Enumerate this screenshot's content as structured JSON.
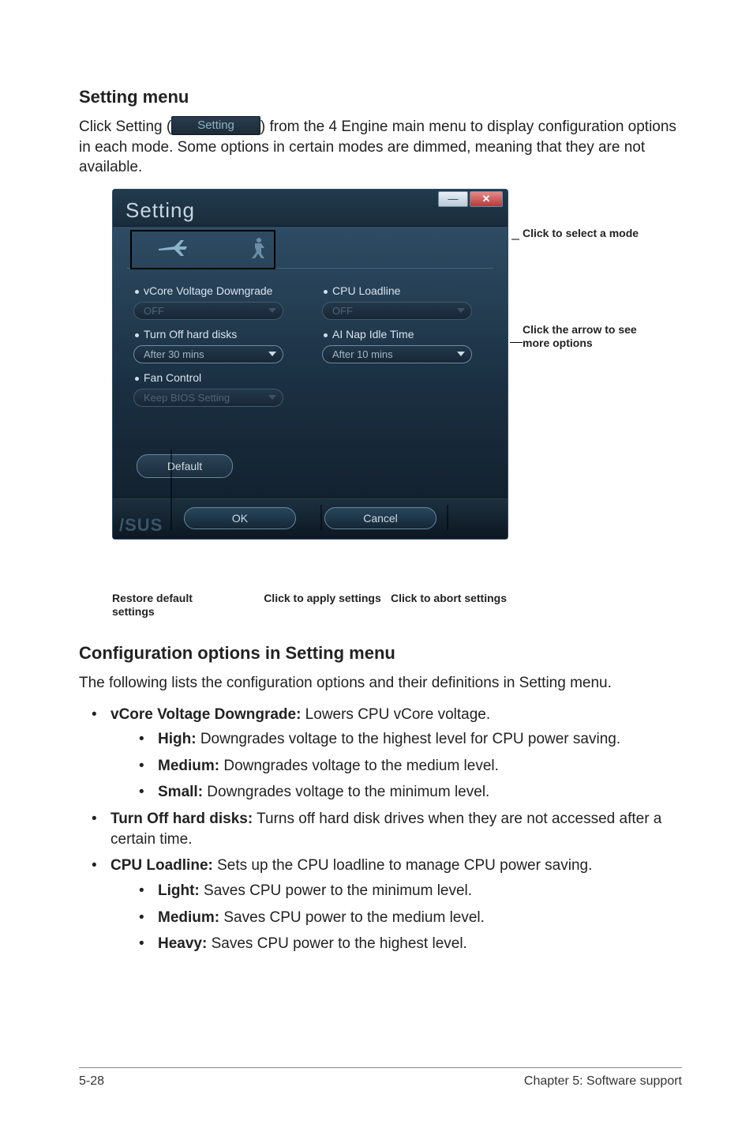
{
  "headings": {
    "setting_menu": "Setting menu",
    "config_options": "Configuration options in Setting menu"
  },
  "intro": {
    "line1_pre": "Click Setting (",
    "inline_btn": "Setting",
    "line1_post": ") from the 4 Engine main menu to display",
    "line2": "configuration options in each mode. Some options in certain modes are dimmed, meaning that they are not available."
  },
  "dialog": {
    "title": "Setting",
    "win_min": "—",
    "win_close": "✕",
    "fields": {
      "vcore": {
        "label": "vCore Voltage Downgrade",
        "value": "OFF"
      },
      "turnoff": {
        "label": "Turn Off hard disks",
        "value": "After 30 mins"
      },
      "fan": {
        "label": "Fan Control",
        "value": "Keep BIOS Setting"
      },
      "loadline": {
        "label": "CPU Loadline",
        "value": "OFF"
      },
      "nap": {
        "label": "AI Nap Idle Time",
        "value": "After 10 mins"
      }
    },
    "default_btn": "Default",
    "ok": "OK",
    "cancel": "Cancel",
    "logo": "/SUS"
  },
  "annotations": {
    "select_mode": "Click to select a mode",
    "arrow": "Click the arrow to see more options",
    "restore": "Restore default settings",
    "apply": "Click to apply settings",
    "abort": "Click to abort settings"
  },
  "config_intro": "The following lists the configuration options and their definitions in Setting menu.",
  "options": {
    "vcore": {
      "title": "vCore Voltage Downgrade:",
      "desc": " Lowers CPU vCore voltage.",
      "high": {
        "t": "High:",
        "d": " Downgrades voltage to the highest level for CPU power saving."
      },
      "medium": {
        "t": "Medium:",
        "d": " Downgrades voltage to the medium level."
      },
      "small": {
        "t": "Small:",
        "d": " Downgrades voltage to the minimum level."
      }
    },
    "turnoff": {
      "title": "Turn Off hard disks:",
      "desc": " Turns off hard disk drives when they are not accessed after a certain time."
    },
    "loadline": {
      "title": "CPU Loadline:",
      "desc": " Sets up the CPU loadline to manage CPU power saving.",
      "light": {
        "t": "Light:",
        "d": " Saves CPU power to the minimum level."
      },
      "medium": {
        "t": "Medium:",
        "d": " Saves CPU power to the medium level."
      },
      "heavy": {
        "t": "Heavy:",
        "d": " Saves CPU power to the highest level."
      }
    }
  },
  "footer": {
    "left": "5-28",
    "right": "Chapter 5: Software support"
  }
}
